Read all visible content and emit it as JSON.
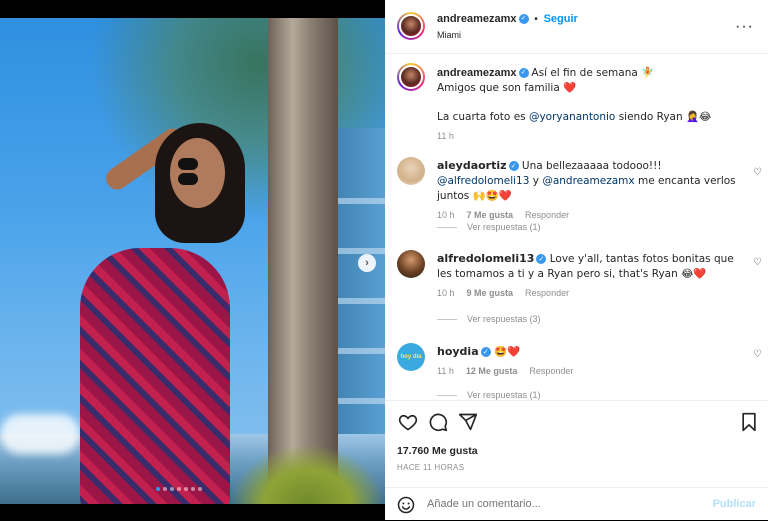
{
  "header": {
    "username": "andreamezamx",
    "verified_mark": "✓",
    "separator": "•",
    "follow_label": "Seguir",
    "location": "Miami",
    "more_label": "···"
  },
  "caption": {
    "username": "andreamezamx",
    "line1": "Así el fin de semana 🧚",
    "line2": "Amigos que son familia ❤️",
    "line3_pre": "La cuarta foto es ",
    "line3_mention": "@yoryanantonio",
    "line3_post": " siendo Ryan 🤦‍♀️😂",
    "time": "11 h"
  },
  "comments": [
    {
      "username": "aleydaortiz",
      "text_pre": "Una bellezaaaaa todooo!!! ",
      "mention1": "@alfredolomeli13",
      "text_mid": " y ",
      "mention2": "@andreamezamx",
      "text_post": " me encanta verlos juntos 🙌🤩❤️",
      "time": "10 h",
      "likes": "7 Me gusta",
      "reply": "Responder",
      "view_replies": "Ver respuestas (1)"
    },
    {
      "username": "alfredolomeli13",
      "text": "Love y'all, tantas fotos bonitas que les tomamos a ti y a Ryan pero si, that's Ryan 😂❤️",
      "time": "10 h",
      "likes": "9 Me gusta",
      "reply": "Responder",
      "view_replies": "Ver respuestas (3)"
    },
    {
      "username": "hoydia",
      "text": "🤩❤️",
      "time": "11 h",
      "likes": "12 Me gusta",
      "reply": "Responder",
      "view_replies": "Ver respuestas (1)",
      "avatar_text": "hoy día"
    }
  ],
  "actions": {
    "likes": "17.760 Me gusta",
    "ago": "HACE 11 HORAS",
    "comment_placeholder": "Añade un comentario...",
    "post_label": "Publicar"
  },
  "carousel": {
    "slide_count": 7,
    "active_slide": 1,
    "next_label": "›"
  },
  "colors": {
    "accent": "#0095f6",
    "verified": "#3897f0",
    "muted": "#8e8e8e",
    "mention": "#00376b",
    "heart": "#ed4956"
  }
}
